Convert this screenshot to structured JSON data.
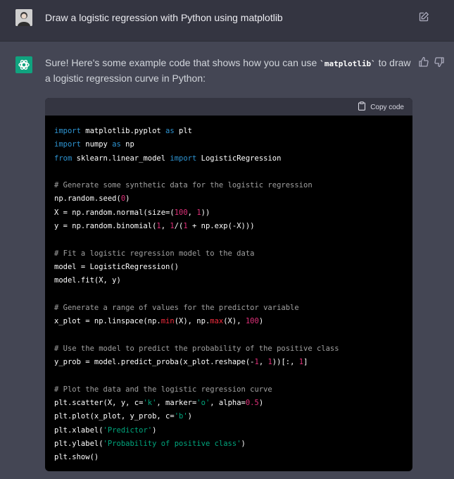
{
  "user_message": {
    "text": "Draw a logistic regression with Python using matplotlib",
    "icons": [
      "avatar",
      "edit-icon"
    ]
  },
  "assistant_message": {
    "intro_before": "Sure! Here's some example code that shows how you can use ",
    "inline_code": "`matplotlib`",
    "intro_after": " to draw a logistic regression curve in Python:",
    "icons": [
      "chatgpt-logo-icon",
      "thumbs-up-icon",
      "thumbs-down-icon"
    ]
  },
  "code_block": {
    "copy_label": "Copy code",
    "lines": [
      [
        {
          "t": "import",
          "c": "kw"
        },
        {
          "t": " matplotlib.pyplot ",
          "c": ""
        },
        {
          "t": "as",
          "c": "kw"
        },
        {
          "t": " plt",
          "c": ""
        }
      ],
      [
        {
          "t": "import",
          "c": "kw"
        },
        {
          "t": " numpy ",
          "c": ""
        },
        {
          "t": "as",
          "c": "kw"
        },
        {
          "t": " np",
          "c": ""
        }
      ],
      [
        {
          "t": "from",
          "c": "kw"
        },
        {
          "t": " sklearn.linear_model ",
          "c": ""
        },
        {
          "t": "import",
          "c": "kw"
        },
        {
          "t": " LogisticRegression",
          "c": ""
        }
      ],
      [],
      [
        {
          "t": "# Generate some synthetic data for the logistic regression",
          "c": "com"
        }
      ],
      [
        {
          "t": "np.random.seed(",
          "c": ""
        },
        {
          "t": "0",
          "c": "num"
        },
        {
          "t": ")",
          "c": ""
        }
      ],
      [
        {
          "t": "X = np.random.normal(size=(",
          "c": ""
        },
        {
          "t": "100",
          "c": "num"
        },
        {
          "t": ", ",
          "c": ""
        },
        {
          "t": "1",
          "c": "num"
        },
        {
          "t": "))",
          "c": ""
        }
      ],
      [
        {
          "t": "y = np.random.binomial(",
          "c": ""
        },
        {
          "t": "1",
          "c": "num"
        },
        {
          "t": ", ",
          "c": ""
        },
        {
          "t": "1",
          "c": "num"
        },
        {
          "t": "/(",
          "c": ""
        },
        {
          "t": "1",
          "c": "num"
        },
        {
          "t": " + np.exp(-X)))",
          "c": ""
        }
      ],
      [],
      [
        {
          "t": "# Fit a logistic regression model to the data",
          "c": "com"
        }
      ],
      [
        {
          "t": "model = LogisticRegression()",
          "c": ""
        }
      ],
      [
        {
          "t": "model.fit(X, y)",
          "c": ""
        }
      ],
      [],
      [
        {
          "t": "# Generate a range of values for the predictor variable",
          "c": "com"
        }
      ],
      [
        {
          "t": "x_plot = np.linspace(np.",
          "c": ""
        },
        {
          "t": "min",
          "c": "fn"
        },
        {
          "t": "(X), np.",
          "c": ""
        },
        {
          "t": "max",
          "c": "fn"
        },
        {
          "t": "(X), ",
          "c": ""
        },
        {
          "t": "100",
          "c": "num"
        },
        {
          "t": ")",
          "c": ""
        }
      ],
      [],
      [
        {
          "t": "# Use the model to predict the probability of the positive class",
          "c": "com"
        }
      ],
      [
        {
          "t": "y_prob = model.predict_proba(x_plot.reshape(-",
          "c": ""
        },
        {
          "t": "1",
          "c": "num"
        },
        {
          "t": ", ",
          "c": ""
        },
        {
          "t": "1",
          "c": "num"
        },
        {
          "t": "))[:, ",
          "c": ""
        },
        {
          "t": "1",
          "c": "num"
        },
        {
          "t": "]",
          "c": ""
        }
      ],
      [],
      [
        {
          "t": "# Plot the data and the logistic regression curve",
          "c": "com"
        }
      ],
      [
        {
          "t": "plt.scatter(X, y, c=",
          "c": ""
        },
        {
          "t": "'k'",
          "c": "str"
        },
        {
          "t": ", marker=",
          "c": ""
        },
        {
          "t": "'o'",
          "c": "str"
        },
        {
          "t": ", alpha=",
          "c": ""
        },
        {
          "t": "0.5",
          "c": "num"
        },
        {
          "t": ")",
          "c": ""
        }
      ],
      [
        {
          "t": "plt.plot(x_plot, y_prob, c=",
          "c": ""
        },
        {
          "t": "'b'",
          "c": "str"
        },
        {
          "t": ")",
          "c": ""
        }
      ],
      [
        {
          "t": "plt.xlabel(",
          "c": ""
        },
        {
          "t": "'Predictor'",
          "c": "str"
        },
        {
          "t": ")",
          "c": ""
        }
      ],
      [
        {
          "t": "plt.ylabel(",
          "c": ""
        },
        {
          "t": "'Probability of positive class'",
          "c": "str"
        },
        {
          "t": ")",
          "c": ""
        }
      ],
      [
        {
          "t": "plt.show()",
          "c": ""
        }
      ]
    ]
  },
  "colors": {
    "page_bg": "#444654",
    "user_row_bg": "#343541",
    "accent": "#10a37f",
    "keyword": "#2e95d3",
    "number": "#df3079",
    "string": "#00a67d",
    "comment": "#a0a0a0",
    "builtin": "#f22c3d"
  }
}
